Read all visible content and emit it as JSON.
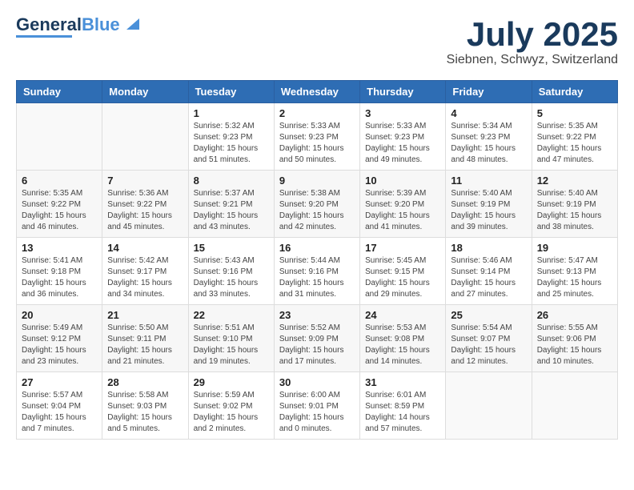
{
  "header": {
    "logo_general": "General",
    "logo_blue": "Blue",
    "month_title": "July 2025",
    "location": "Siebnen, Schwyz, Switzerland"
  },
  "weekdays": [
    "Sunday",
    "Monday",
    "Tuesday",
    "Wednesday",
    "Thursday",
    "Friday",
    "Saturday"
  ],
  "weeks": [
    [
      {
        "day": "",
        "info": ""
      },
      {
        "day": "",
        "info": ""
      },
      {
        "day": "1",
        "info": "Sunrise: 5:32 AM\nSunset: 9:23 PM\nDaylight: 15 hours\nand 51 minutes."
      },
      {
        "day": "2",
        "info": "Sunrise: 5:33 AM\nSunset: 9:23 PM\nDaylight: 15 hours\nand 50 minutes."
      },
      {
        "day": "3",
        "info": "Sunrise: 5:33 AM\nSunset: 9:23 PM\nDaylight: 15 hours\nand 49 minutes."
      },
      {
        "day": "4",
        "info": "Sunrise: 5:34 AM\nSunset: 9:23 PM\nDaylight: 15 hours\nand 48 minutes."
      },
      {
        "day": "5",
        "info": "Sunrise: 5:35 AM\nSunset: 9:22 PM\nDaylight: 15 hours\nand 47 minutes."
      }
    ],
    [
      {
        "day": "6",
        "info": "Sunrise: 5:35 AM\nSunset: 9:22 PM\nDaylight: 15 hours\nand 46 minutes."
      },
      {
        "day": "7",
        "info": "Sunrise: 5:36 AM\nSunset: 9:22 PM\nDaylight: 15 hours\nand 45 minutes."
      },
      {
        "day": "8",
        "info": "Sunrise: 5:37 AM\nSunset: 9:21 PM\nDaylight: 15 hours\nand 43 minutes."
      },
      {
        "day": "9",
        "info": "Sunrise: 5:38 AM\nSunset: 9:20 PM\nDaylight: 15 hours\nand 42 minutes."
      },
      {
        "day": "10",
        "info": "Sunrise: 5:39 AM\nSunset: 9:20 PM\nDaylight: 15 hours\nand 41 minutes."
      },
      {
        "day": "11",
        "info": "Sunrise: 5:40 AM\nSunset: 9:19 PM\nDaylight: 15 hours\nand 39 minutes."
      },
      {
        "day": "12",
        "info": "Sunrise: 5:40 AM\nSunset: 9:19 PM\nDaylight: 15 hours\nand 38 minutes."
      }
    ],
    [
      {
        "day": "13",
        "info": "Sunrise: 5:41 AM\nSunset: 9:18 PM\nDaylight: 15 hours\nand 36 minutes."
      },
      {
        "day": "14",
        "info": "Sunrise: 5:42 AM\nSunset: 9:17 PM\nDaylight: 15 hours\nand 34 minutes."
      },
      {
        "day": "15",
        "info": "Sunrise: 5:43 AM\nSunset: 9:16 PM\nDaylight: 15 hours\nand 33 minutes."
      },
      {
        "day": "16",
        "info": "Sunrise: 5:44 AM\nSunset: 9:16 PM\nDaylight: 15 hours\nand 31 minutes."
      },
      {
        "day": "17",
        "info": "Sunrise: 5:45 AM\nSunset: 9:15 PM\nDaylight: 15 hours\nand 29 minutes."
      },
      {
        "day": "18",
        "info": "Sunrise: 5:46 AM\nSunset: 9:14 PM\nDaylight: 15 hours\nand 27 minutes."
      },
      {
        "day": "19",
        "info": "Sunrise: 5:47 AM\nSunset: 9:13 PM\nDaylight: 15 hours\nand 25 minutes."
      }
    ],
    [
      {
        "day": "20",
        "info": "Sunrise: 5:49 AM\nSunset: 9:12 PM\nDaylight: 15 hours\nand 23 minutes."
      },
      {
        "day": "21",
        "info": "Sunrise: 5:50 AM\nSunset: 9:11 PM\nDaylight: 15 hours\nand 21 minutes."
      },
      {
        "day": "22",
        "info": "Sunrise: 5:51 AM\nSunset: 9:10 PM\nDaylight: 15 hours\nand 19 minutes."
      },
      {
        "day": "23",
        "info": "Sunrise: 5:52 AM\nSunset: 9:09 PM\nDaylight: 15 hours\nand 17 minutes."
      },
      {
        "day": "24",
        "info": "Sunrise: 5:53 AM\nSunset: 9:08 PM\nDaylight: 15 hours\nand 14 minutes."
      },
      {
        "day": "25",
        "info": "Sunrise: 5:54 AM\nSunset: 9:07 PM\nDaylight: 15 hours\nand 12 minutes."
      },
      {
        "day": "26",
        "info": "Sunrise: 5:55 AM\nSunset: 9:06 PM\nDaylight: 15 hours\nand 10 minutes."
      }
    ],
    [
      {
        "day": "27",
        "info": "Sunrise: 5:57 AM\nSunset: 9:04 PM\nDaylight: 15 hours\nand 7 minutes."
      },
      {
        "day": "28",
        "info": "Sunrise: 5:58 AM\nSunset: 9:03 PM\nDaylight: 15 hours\nand 5 minutes."
      },
      {
        "day": "29",
        "info": "Sunrise: 5:59 AM\nSunset: 9:02 PM\nDaylight: 15 hours\nand 2 minutes."
      },
      {
        "day": "30",
        "info": "Sunrise: 6:00 AM\nSunset: 9:01 PM\nDaylight: 15 hours\nand 0 minutes."
      },
      {
        "day": "31",
        "info": "Sunrise: 6:01 AM\nSunset: 8:59 PM\nDaylight: 14 hours\nand 57 minutes."
      },
      {
        "day": "",
        "info": ""
      },
      {
        "day": "",
        "info": ""
      }
    ]
  ]
}
